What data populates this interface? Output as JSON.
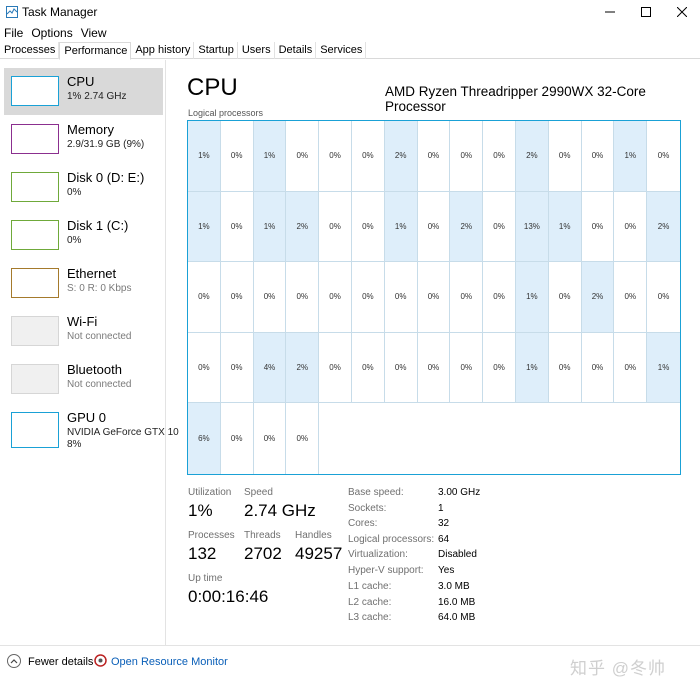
{
  "window": {
    "title": "Task Manager"
  },
  "menu": [
    "File",
    "Options",
    "View"
  ],
  "tabs": [
    "Processes",
    "Performance",
    "App history",
    "Startup",
    "Users",
    "Details",
    "Services"
  ],
  "sidebar": [
    {
      "name": "CPU",
      "sub": "1% 2.74 GHz",
      "sub2": "",
      "muted": false
    },
    {
      "name": "Memory",
      "sub": "2.9/31.9 GB (9%)",
      "sub2": "",
      "muted": false
    },
    {
      "name": "Disk 0 (D: E:)",
      "sub": "0%",
      "sub2": "",
      "muted": false
    },
    {
      "name": "Disk 1 (C:)",
      "sub": "0%",
      "sub2": "",
      "muted": false
    },
    {
      "name": "Ethernet",
      "sub": "S: 0 R: 0 Kbps",
      "sub2": "",
      "muted": false
    },
    {
      "name": "Wi-Fi",
      "sub": "Not connected",
      "sub2": "",
      "muted": true
    },
    {
      "name": "Bluetooth",
      "sub": "Not connected",
      "sub2": "",
      "muted": true
    },
    {
      "name": "GPU 0",
      "sub": "NVIDIA GeForce GTX 10",
      "sub2": "8%",
      "muted": false
    }
  ],
  "main": {
    "title": "CPU",
    "model": "AMD Ryzen Threadripper 2990WX 32-Core Processor",
    "grid_label": "Logical processors",
    "processors": [
      "1%",
      "0%",
      "1%",
      "0%",
      "0%",
      "0%",
      "2%",
      "0%",
      "0%",
      "0%",
      "2%",
      "0%",
      "0%",
      "1%",
      "0%",
      "1%",
      "0%",
      "1%",
      "2%",
      "0%",
      "0%",
      "1%",
      "0%",
      "2%",
      "0%",
      "13%",
      "1%",
      "0%",
      "0%",
      "2%",
      "0%",
      "0%",
      "0%",
      "0%",
      "0%",
      "0%",
      "0%",
      "0%",
      "0%",
      "0%",
      "1%",
      "0%",
      "2%",
      "0%",
      "0%",
      "0%",
      "0%",
      "4%",
      "2%",
      "0%",
      "0%",
      "0%",
      "0%",
      "0%",
      "0%",
      "1%",
      "0%",
      "0%",
      "0%",
      "1%",
      "6%",
      "0%",
      "0%",
      "0%"
    ],
    "highlighted": [
      0,
      2,
      6,
      10,
      13,
      15,
      17,
      18,
      21,
      23,
      25,
      26,
      29,
      40,
      42,
      47,
      48,
      55,
      59,
      60
    ]
  },
  "stats": {
    "utilization_label": "Utilization",
    "utilization": "1%",
    "speed_label": "Speed",
    "speed": "2.74 GHz",
    "processes_label": "Processes",
    "processes": "132",
    "threads_label": "Threads",
    "threads": "2702",
    "handles_label": "Handles",
    "handles": "49257",
    "uptime_label": "Up time",
    "uptime": "0:00:16:46"
  },
  "details": [
    {
      "key": "Base speed:",
      "value": "3.00 GHz"
    },
    {
      "key": "Sockets:",
      "value": "1"
    },
    {
      "key": "Cores:",
      "value": "32"
    },
    {
      "key": "Logical processors:",
      "value": "64"
    },
    {
      "key": "Virtualization:",
      "value": "Disabled"
    },
    {
      "key": "Hyper-V support:",
      "value": "Yes"
    },
    {
      "key": "L1 cache:",
      "value": "3.0 MB"
    },
    {
      "key": "L2 cache:",
      "value": "16.0 MB"
    },
    {
      "key": "L3 cache:",
      "value": "64.0 MB"
    }
  ],
  "footer": {
    "fewer": "Fewer details",
    "monitor": "Open Resource Monitor",
    "watermark": "知乎 @冬帅"
  },
  "colors": {
    "accent": "#1aa1d6",
    "highlight": "#deeefa",
    "link": "#0a5fb8",
    "selected": "#d9d9d9"
  }
}
